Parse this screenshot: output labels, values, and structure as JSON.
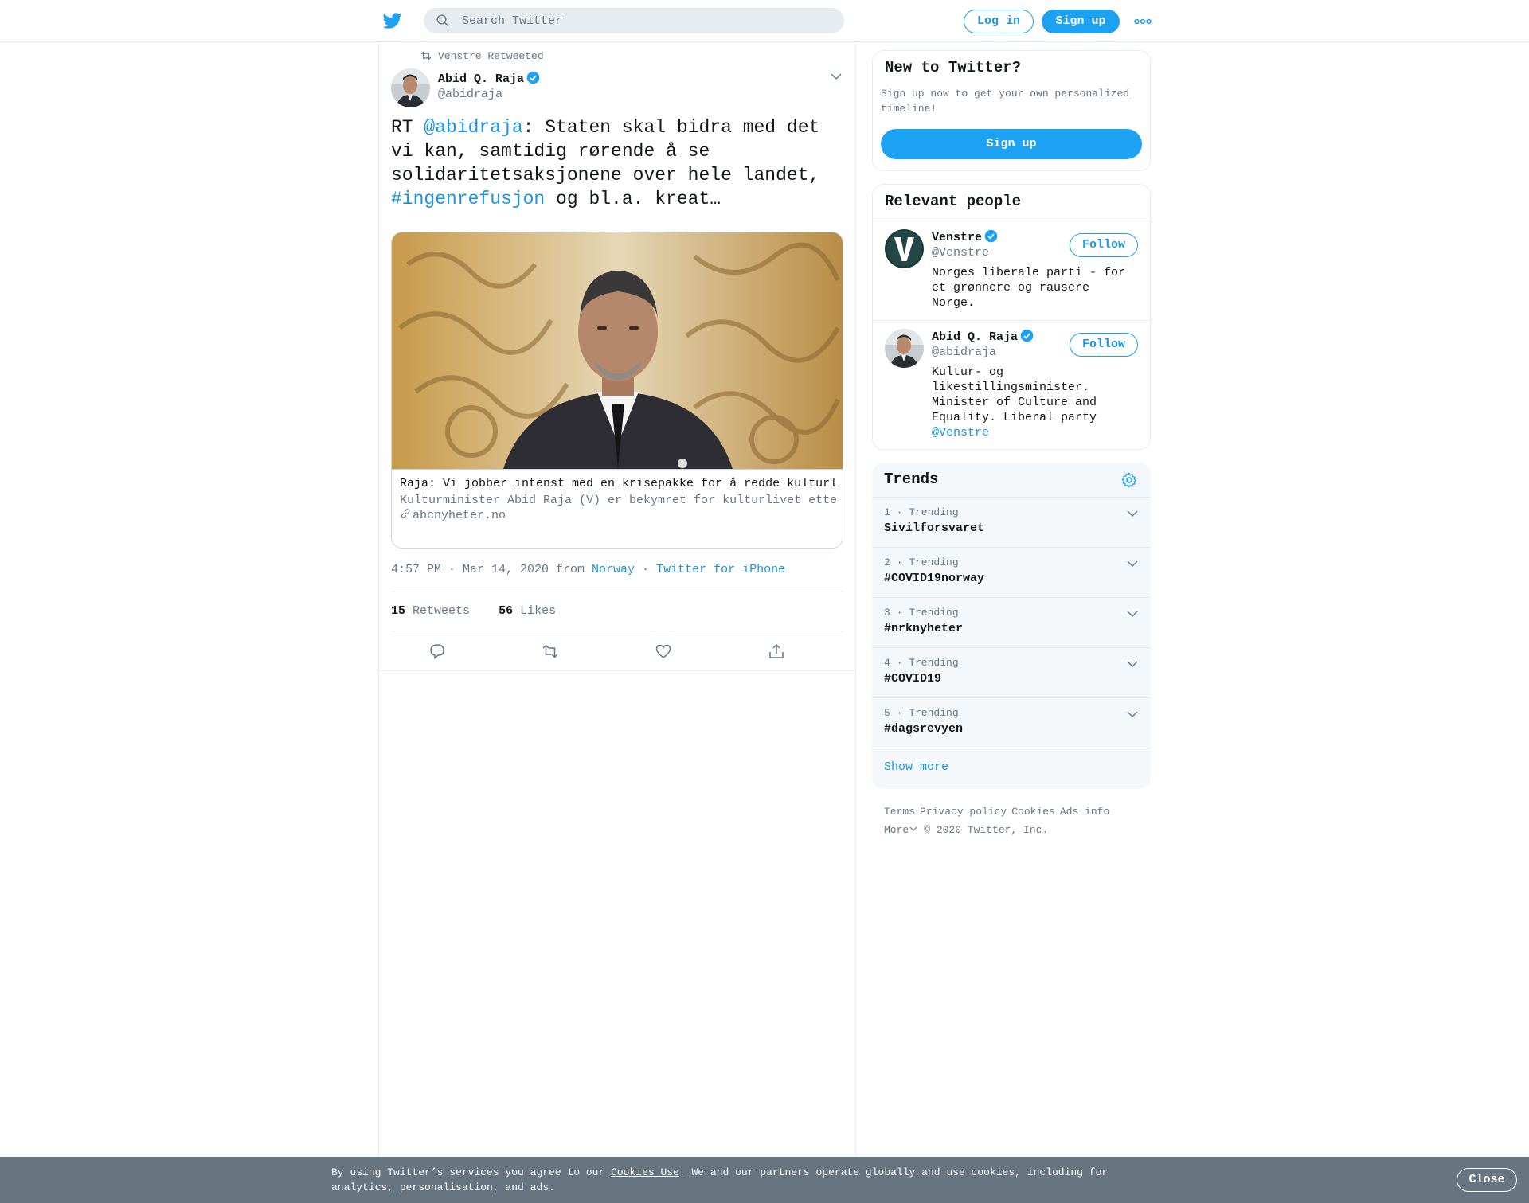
{
  "header": {
    "search_placeholder": "Search Twitter",
    "login_label": "Log in",
    "signup_label": "Sign up"
  },
  "tweet": {
    "retweeted_by": "Venstre Retweeted",
    "author_name": "Abid Q. Raja",
    "author_handle": "@abidraja",
    "text_prefix": "RT ",
    "text_mention": "@abidraja",
    "text_middle": ": Staten skal bidra med det vi kan, samtidig rørende å se solidaritetsaksjonene over hele landet, ",
    "text_hashtag": "#ingenrefusjon",
    "text_suffix": " og bl.a. kreat…",
    "card": {
      "title": "Raja: Vi jobber intenst med en krisepakke for å redde kulturlivet",
      "description": "Kulturminister Abid Raja (V) er bekymret for kulturlivet etter coronautbruddet. – Vi jobber intenst med en krisepakke for å redde kulturlivet",
      "domain": "abcnyheter.no"
    },
    "time": "4:57 PM · Mar 14, 2020 from ",
    "location": "Norway",
    "separator": " · ",
    "source": "Twitter for iPhone",
    "retweets_count": "15",
    "retweets_label": "Retweets",
    "likes_count": "56",
    "likes_label": "Likes"
  },
  "sidebar": {
    "new_to_twitter": {
      "title": "New to Twitter?",
      "text": "Sign up now to get your own personalized timeline!",
      "button": "Sign up"
    },
    "relevant_people": {
      "title": "Relevant people",
      "people": [
        {
          "name": "Venstre",
          "handle": "@Venstre",
          "bio": "Norges liberale parti - for et grønnere og rausere Norge.",
          "follow": "Follow"
        },
        {
          "name": "Abid Q. Raja",
          "handle": "@abidraja",
          "bio": "Kultur- og likestillingsminister. Minister of Culture and Equality. Liberal party ",
          "bio_link": "@Venstre",
          "follow": "Follow"
        }
      ]
    },
    "trends": {
      "title": "Trends",
      "items": [
        {
          "meta": "1 · Trending",
          "name": "Sivilforsvaret"
        },
        {
          "meta": "2 · Trending",
          "name": "#COVID19norway"
        },
        {
          "meta": "3 · Trending",
          "name": "#nrknyheter"
        },
        {
          "meta": "4 · Trending",
          "name": "#COVID19"
        },
        {
          "meta": "5 · Trending",
          "name": "#dagsrevyen"
        }
      ],
      "show_more": "Show more"
    },
    "footer": {
      "terms": "Terms",
      "privacy": "Privacy policy",
      "cookies": "Cookies",
      "ads": "Ads info",
      "more": "More",
      "copyright": "© 2020 Twitter, Inc."
    }
  },
  "cookie_banner": {
    "text_before": "By using Twitter’s services you agree to our ",
    "link": "Cookies Use",
    "text_after": ". We and our partners operate globally and use cookies, including for analytics, personalisation, and ads.",
    "close": "Close"
  },
  "colors": {
    "accent": "#1da1f2",
    "link": "#1b95e0",
    "muted": "#657786",
    "cookie_bar": "#66757f"
  },
  "icons": [
    "twitter-bird-icon",
    "search-icon",
    "more-dots-icon",
    "retweet-icon",
    "verified-badge-icon",
    "chevron-down-icon",
    "link-icon",
    "reply-icon",
    "like-icon",
    "share-icon",
    "gear-icon"
  ]
}
